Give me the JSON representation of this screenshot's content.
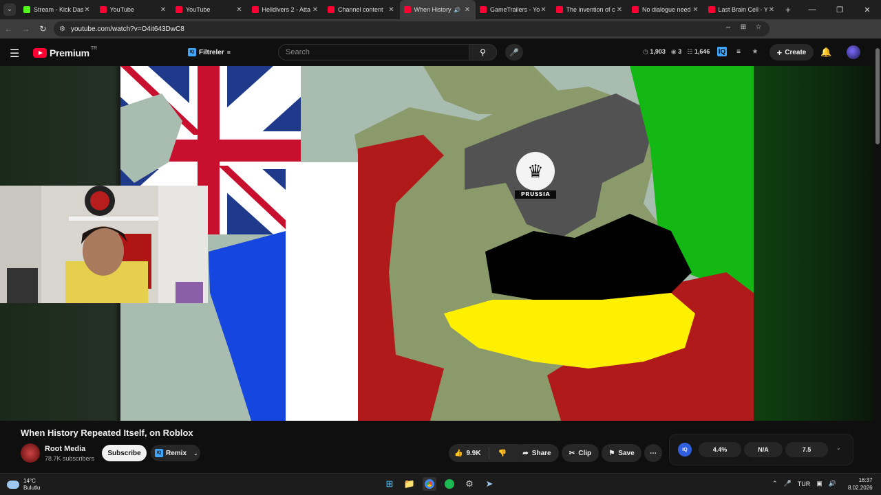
{
  "browser": {
    "tabs": [
      {
        "title": "Stream - Kick Dash",
        "favicon": "kick-icon",
        "active": false
      },
      {
        "title": "YouTube",
        "favicon": "youtube-icon",
        "active": false
      },
      {
        "title": "YouTube",
        "favicon": "youtube-icon",
        "active": false
      },
      {
        "title": "Helldivers 2 - Atta",
        "favicon": "youtube-icon",
        "active": false
      },
      {
        "title": "Channel content",
        "favicon": "youtube-icon",
        "active": false
      },
      {
        "title": "When History",
        "favicon": "youtube-icon",
        "active": true
      },
      {
        "title": "GameTrailers - Yo",
        "favicon": "youtube-icon",
        "active": false
      },
      {
        "title": "The invention of c",
        "favicon": "youtube-icon",
        "active": false
      },
      {
        "title": "No dialogue need",
        "favicon": "youtube-icon",
        "active": false
      },
      {
        "title": "Last Brain Cell - Y",
        "favicon": "youtube-icon",
        "active": false
      }
    ],
    "url": "youtube.com/watch?v=O4it643DwC8"
  },
  "header": {
    "brand": "Premium",
    "country_code": "TR",
    "filter_label": "Filtreler",
    "search_placeholder": "Search",
    "stat_views": "1,903",
    "stat_eye": "3",
    "stat_other": "1,646",
    "create_label": "Create"
  },
  "video": {
    "map_label": "PRUSSIA",
    "colors": {
      "uk_blue": "#1f3a8a",
      "uk_red": "#c8102e",
      "france_blue": "#1546e0",
      "red": "#b01a1a",
      "green": "#14b814",
      "yellow": "#ffef00",
      "black": "#000000",
      "land": "#8a9a6a",
      "sea": "#a9bcb0"
    }
  },
  "meta": {
    "title": "When History Repeated Itself, on Roblox",
    "channel_name": "Root Media",
    "subscribers": "78.7K subscribers",
    "subscribe_label": "Subscribe",
    "remix_label": "Remix",
    "likes": "9.9K",
    "share_label": "Share",
    "clip_label": "Clip",
    "save_label": "Save"
  },
  "stats_panel": {
    "metric_1": "4.4%",
    "metric_2": "N/A",
    "metric_3": "7.5"
  },
  "taskbar": {
    "temperature": "14°C",
    "condition": "Bulutlu",
    "language": "TUR",
    "time": "16:37",
    "date": "8.02.2026"
  }
}
